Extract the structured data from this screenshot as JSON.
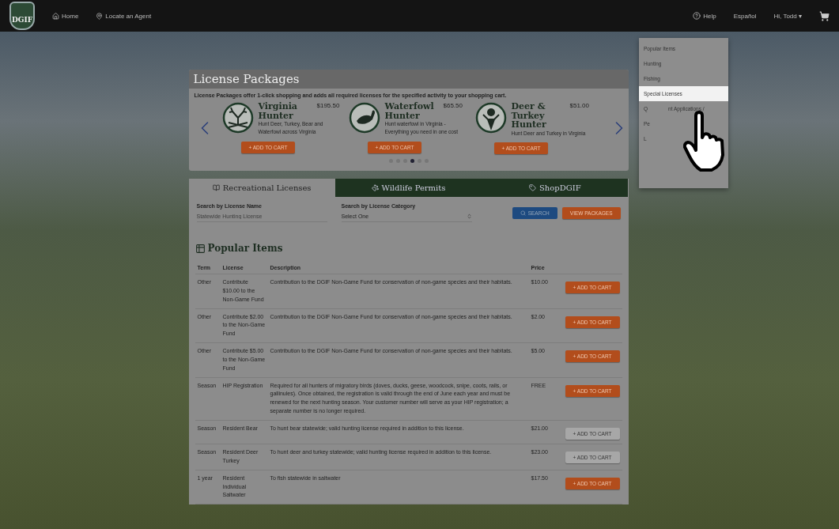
{
  "nav": {
    "left": [
      {
        "kind": "home",
        "label": "Home"
      },
      {
        "kind": "pin",
        "label": "Locate an Agent"
      }
    ],
    "right": [
      {
        "kind": "help",
        "label": "Help"
      },
      {
        "kind": "plain",
        "label": "Español"
      },
      {
        "kind": "plain",
        "label": "Hi, Todd ▾"
      }
    ],
    "logo": "DGIF"
  },
  "dropdown": {
    "items": [
      {
        "parts": [
          "Popular Items"
        ],
        "selected": false
      },
      {
        "parts": [
          "Hunting"
        ],
        "selected": false
      },
      {
        "parts": [
          "Fishing"
        ],
        "selected": false
      },
      {
        "parts": [
          "Special Licenses"
        ],
        "selected": true
      },
      {
        "parts": [
          "Q",
          "nt Applications /"
        ],
        "selected": false
      },
      {
        "parts": [
          "Pe"
        ],
        "selected": false
      },
      {
        "parts": [
          "L"
        ],
        "selected": false
      }
    ]
  },
  "packages": {
    "title": "License Packages",
    "intro": "License Packages offer 1-click shopping and adds all required licenses for the specified activity to your shopping cart.",
    "items": [
      {
        "kind": "antlers",
        "name": "Virginia Hunter",
        "price": "$195.50",
        "description": "Hunt Deer, Turkey, Bear and Waterfowl across Virginia",
        "button": "+ ADD TO CART"
      },
      {
        "kind": "duck",
        "name": "Waterfowl Hunter",
        "price": "$65.50",
        "description": "Hunt waterfowl in Virginia - Everything you need in one cost",
        "button": "+ ADD TO CART"
      },
      {
        "kind": "deer",
        "name": "Deer & Turkey Hunter",
        "price": "$51.00",
        "description": "Hunt Deer and Turkey in Virginia",
        "button": "+ ADD TO CART"
      }
    ],
    "dots": [
      {
        "selected": false
      },
      {
        "selected": false
      },
      {
        "selected": false
      },
      {
        "selected": true
      },
      {
        "selected": false
      },
      {
        "selected": false
      }
    ]
  },
  "tabs": [
    {
      "kind": "book",
      "label": "Recreational Licenses",
      "selected": true
    },
    {
      "kind": "paw",
      "label": "Wildlife Permits",
      "selected": false
    },
    {
      "kind": "tag",
      "label": "ShopDGIF",
      "selected": false
    }
  ],
  "search": {
    "name_label": "Search by License Name",
    "name_placeholder": "Statewide Hunting License",
    "category_label": "Search by License Category",
    "category_value": "Select One",
    "search_button": "SEARCH",
    "packages_button": "VIEW PACKAGES"
  },
  "popular": {
    "title": "Popular Items",
    "columns": [
      "Term",
      "License",
      "Description",
      "Price"
    ],
    "rows": [
      {
        "term": "Other",
        "license": "Contribute $10.00 to the Non-Game Fund",
        "description": "Contribution to the DGIF Non-Game Fund for conservation of non-game species and their habitats.",
        "price": "$10.00",
        "button": "+ ADD TO CART",
        "kind": "primary"
      },
      {
        "term": "Other",
        "license": "Contribute $2.00 to the Non-Game Fund",
        "description": "Contribution to the DGIF Non-Game Fund for conservation of non-game species and their habitats.",
        "price": "$2.00",
        "button": "+ ADD TO CART",
        "kind": "primary"
      },
      {
        "term": "Other",
        "license": "Contribute $5.00 to the Non-Game Fund",
        "description": "Contribution to the DGIF Non-Game Fund for conservation of non-game species and their habitats.",
        "price": "$5.00",
        "button": "+ ADD TO CART",
        "kind": "primary"
      },
      {
        "term": "Season",
        "license": "HIP Registration",
        "description": "Required for all hunters of migratory birds (doves, ducks, geese, woodcock, snipe, coots, rails, or gallinules). Once obtained, the registration is valid through the end of June each year and must be renewed for the next hunting season. Your customer number will serve as your HIP registration; a separate number is no longer required.",
        "price": "FREE",
        "button": "+ ADD TO CART",
        "kind": "primary"
      },
      {
        "term": "Season",
        "license": "Resident Bear",
        "description": "To hunt bear statewide; valid hunting license required in addition to this license.",
        "price": "$21.00",
        "button": "+ ADD TO CART",
        "kind": "secondary"
      },
      {
        "term": "Season",
        "license": "Resident Deer Turkey",
        "description": "To hunt deer and turkey statewide; valid hunting license required in addition to this license.",
        "price": "$23.00",
        "button": "+ ADD TO CART",
        "kind": "secondary"
      },
      {
        "term": "1 year",
        "license": "Resident Individual Saltwater",
        "description": "To fish statewide in saltwater",
        "price": "$17.50",
        "button": "+ ADD TO CART",
        "kind": "primary"
      }
    ]
  }
}
